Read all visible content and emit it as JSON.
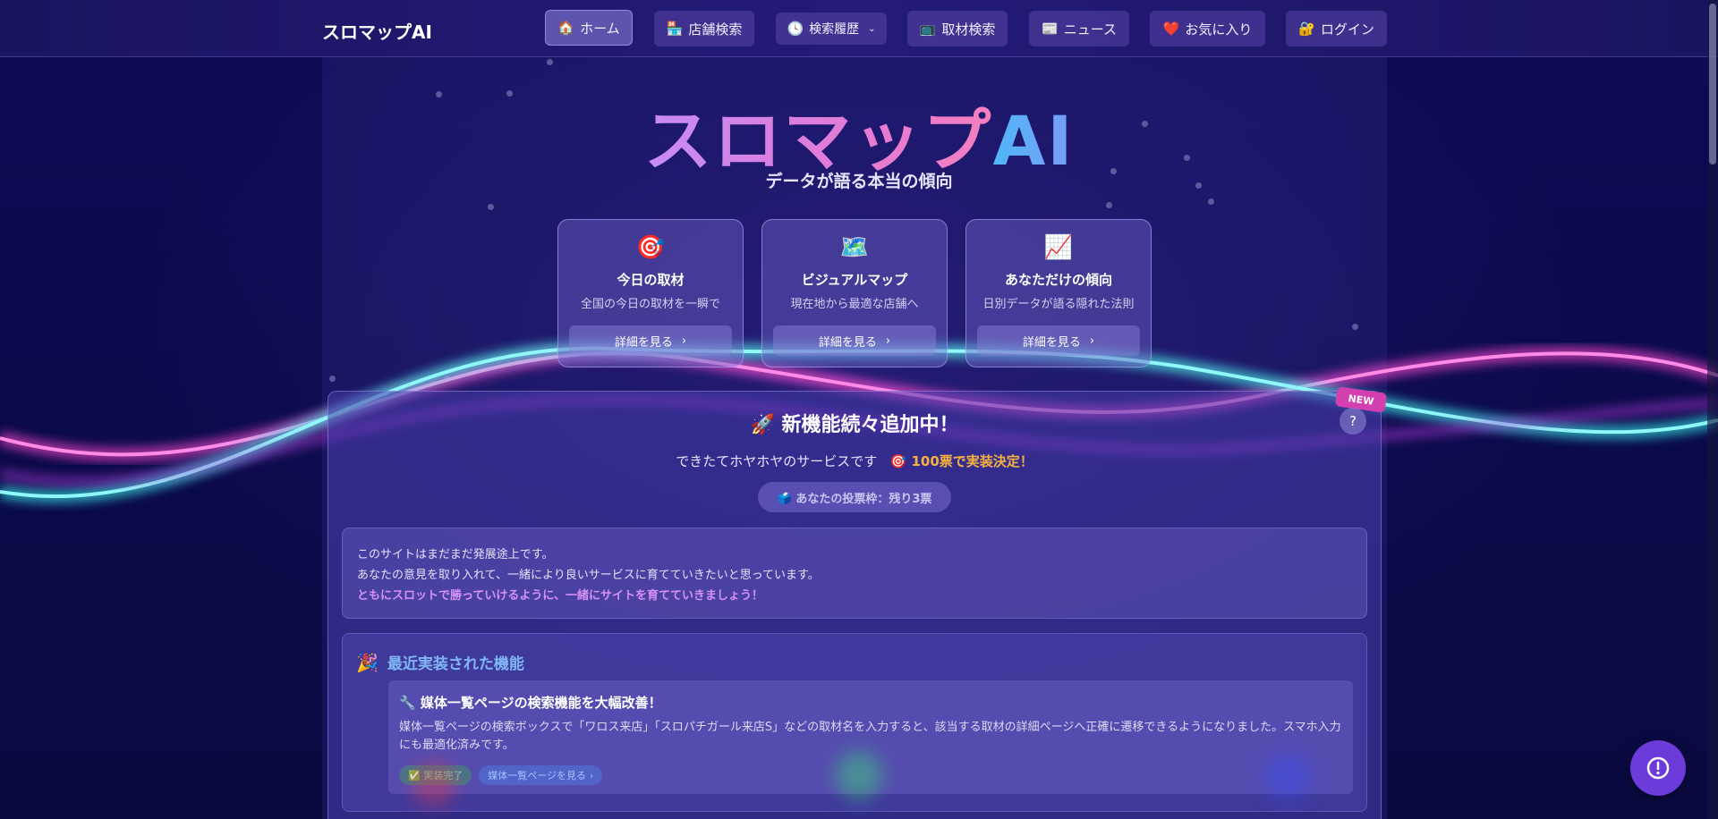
{
  "header": {
    "brand": "スロマップAI",
    "nav": [
      {
        "icon": "🏠",
        "label": "ホーム",
        "active": true
      },
      {
        "icon": "🏪",
        "label": "店舗検索"
      },
      {
        "icon": "🕓",
        "label": "検索履歴",
        "dropdown": true
      },
      {
        "icon": "📺",
        "label": "取材検索"
      },
      {
        "icon": "📰",
        "label": "ニュース"
      },
      {
        "icon": "❤️",
        "label": "お気に入り"
      },
      {
        "icon": "🔐",
        "label": "ログイン"
      }
    ]
  },
  "hero": {
    "title_part1": "スロマップ",
    "title_part2": "AI",
    "subtitle": "データが語る本当の傾向"
  },
  "cards": [
    {
      "icon": "🎯",
      "title": "今日の取材",
      "desc": "全国の今日の取材を一瞬で",
      "button": "詳細を見る"
    },
    {
      "icon": "🗺️",
      "title": "ビジュアルマップ",
      "desc": "現在地から最適な店舗へ",
      "button": "詳細を見る"
    },
    {
      "icon": "📈",
      "title": "あなただけの傾向",
      "desc": "日別データが語る隠れた法則",
      "button": "詳細を見る"
    }
  ],
  "announcement": {
    "badge": "NEW",
    "help": "?",
    "title": "🚀 新機能続々追加中！",
    "sub_text": "できたてホヤホヤのサービスです",
    "sub_highlight": "🎯 100票で実装決定！",
    "vote": "🗳️ あなたの投票枠：残り3票",
    "info_line1": "このサイトはまだまだ発展途上です。",
    "info_line2": "あなたの意見を取り入れて、一緒により良いサービスに育てていきたいと思っています。",
    "info_line3": "ともにスロットで勝っていけるように、一緒にサイトを育てていきましょう！"
  },
  "recent": {
    "icon": "🎉",
    "heading": "最近実装された機能",
    "item_title": "🔧 媒体一覧ページの検索機能を大幅改善！",
    "item_desc": "媒体一覧ページの検索ボックスで「ワロス来店」「スロパチガール来店S」などの取材名を入力すると、該当する取材の詳細ページへ正確に遷移できるようになりました。スマホ入力にも最適化済みです。",
    "tag_done": "✅ 実装完了",
    "tag_link": "媒体一覧ページを見る"
  },
  "colors": {
    "background": "#0b0a4a",
    "accent_pink": "#e37ad6",
    "accent_blue": "#4fb7f7",
    "highlight_orange": "#f5b13f",
    "fab": "#6d3bd9"
  }
}
